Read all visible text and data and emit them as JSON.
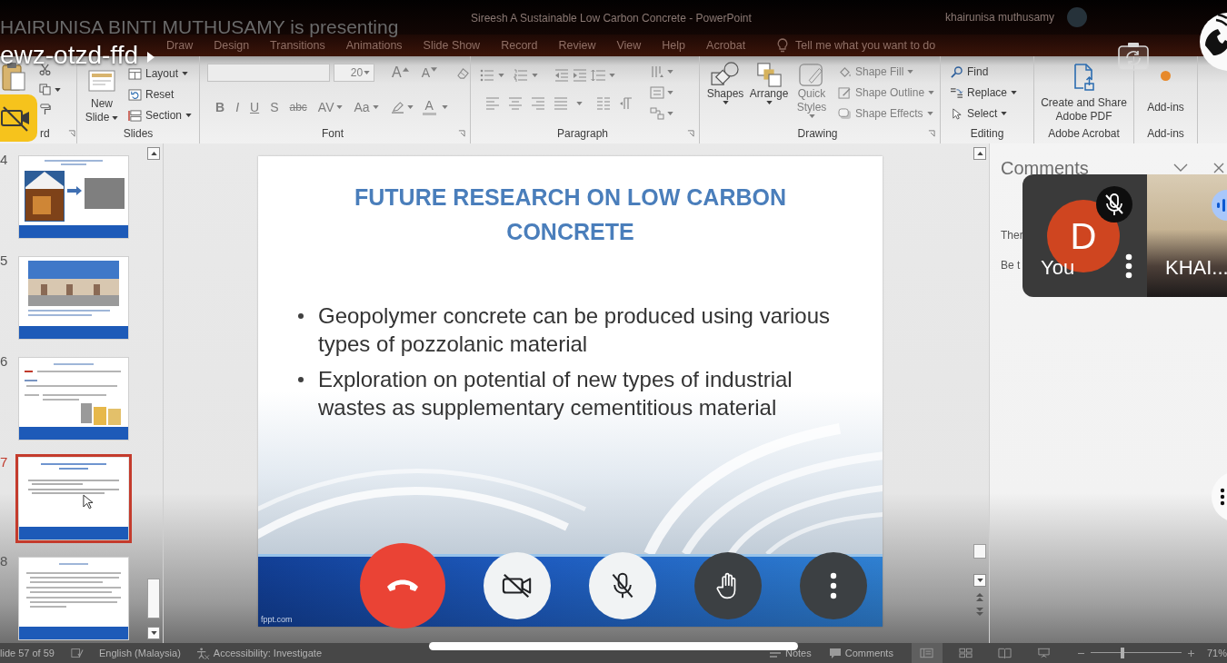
{
  "window": {
    "title": "Sireesh A Sustainable Low Carbon Concrete - PowerPoint",
    "user": "khairunisa muthusamy"
  },
  "menu": {
    "tabs": [
      {
        "label": "Draw",
        "selected": false
      },
      {
        "label": "Design",
        "selected": false
      },
      {
        "label": "Transitions",
        "selected": false
      },
      {
        "label": "Animations",
        "selected": false
      },
      {
        "label": "Slide Show",
        "selected": false
      },
      {
        "label": "Record",
        "selected": false
      },
      {
        "label": "Review",
        "selected": false
      },
      {
        "label": "View",
        "selected": false
      },
      {
        "label": "Help",
        "selected": false
      },
      {
        "label": "Acrobat",
        "selected": false
      }
    ],
    "search": {
      "placeholder": "Tell me what you want to do"
    }
  },
  "ribbon": {
    "clipboard": {
      "label": "rd"
    },
    "slides": {
      "label": "Slides",
      "new_slide": "New Slide",
      "buttons": [
        "Layout",
        "Reset",
        "Section"
      ]
    },
    "font": {
      "label": "Font",
      "disabled": true,
      "size": "20",
      "grow": "A",
      "shrink": "A",
      "buttons": [
        "B",
        "I",
        "U",
        "S",
        "abc",
        "AV",
        "Aa"
      ],
      "font_color_button": "A"
    },
    "paragraph": {
      "label": "Paragraph",
      "disabled": true
    },
    "drawing": {
      "label": "Drawing",
      "large": [
        {
          "label": "Shapes",
          "disabled": false
        },
        {
          "label": "Arrange",
          "disabled": false
        },
        {
          "label": "Quick Styles",
          "disabled": true
        }
      ],
      "small": [
        {
          "label": "Shape Fill",
          "disabled": true
        },
        {
          "label": "Shape Outline",
          "disabled": true
        },
        {
          "label": "Shape Effects",
          "disabled": true
        }
      ]
    },
    "editing": {
      "label": "Editing",
      "buttons": [
        "Find",
        "Replace",
        "Select"
      ]
    },
    "acrobat": {
      "label": "Adobe Acrobat",
      "button": "Create and Share Adobe PDF"
    },
    "addins": {
      "label": "Add-ins",
      "button": "Add-ins"
    }
  },
  "thumbnails": [
    {
      "number": "4",
      "kind": "photos",
      "selected": false
    },
    {
      "number": "5",
      "kind": "building",
      "selected": false
    },
    {
      "number": "6",
      "kind": "text_images",
      "selected": false
    },
    {
      "number": "7",
      "kind": "bullets",
      "selected": true
    },
    {
      "number": "8",
      "kind": "text",
      "selected": false
    }
  ],
  "slide": {
    "title": "FUTURE RESEARCH ON LOW CARBON CONCRETE",
    "bullets": [
      "Geopolymer concrete can be produced using various types of pozzolanic material",
      "Exploration on potential of new types of industrial wastes as supplementary cementitious material"
    ],
    "footer": "fppt.com"
  },
  "comments": {
    "title": "Comments",
    "lines": [
      "Ther",
      "Be t"
    ]
  },
  "status_bar": {
    "slide_info": "lide 57 of 59",
    "language": "English (Malaysia)",
    "accessibility": "Accessibility: Investigate",
    "notes": "Notes",
    "comments": "Comments",
    "views": [
      {
        "kind": "normal",
        "selected": true
      },
      {
        "kind": "sorter",
        "selected": false
      },
      {
        "kind": "reading",
        "selected": false
      },
      {
        "kind": "show",
        "selected": false
      }
    ],
    "zoom": {
      "level": 0.35,
      "reading": "71%"
    }
  },
  "meet": {
    "presenter": "HAIRUNISA BINTI MUTHUSAMY is presenting",
    "meeting_code": "ewz-otzd-ffd",
    "controls": [
      {
        "kind": "end_call"
      },
      {
        "kind": "camera",
        "on": false
      },
      {
        "kind": "mic",
        "on": false
      },
      {
        "kind": "hand"
      },
      {
        "kind": "more"
      }
    ],
    "self_tile": {
      "initial": "D",
      "label": "You",
      "muted": true
    },
    "remote_tile": {
      "label": "KHAI...",
      "speaking": true
    }
  }
}
